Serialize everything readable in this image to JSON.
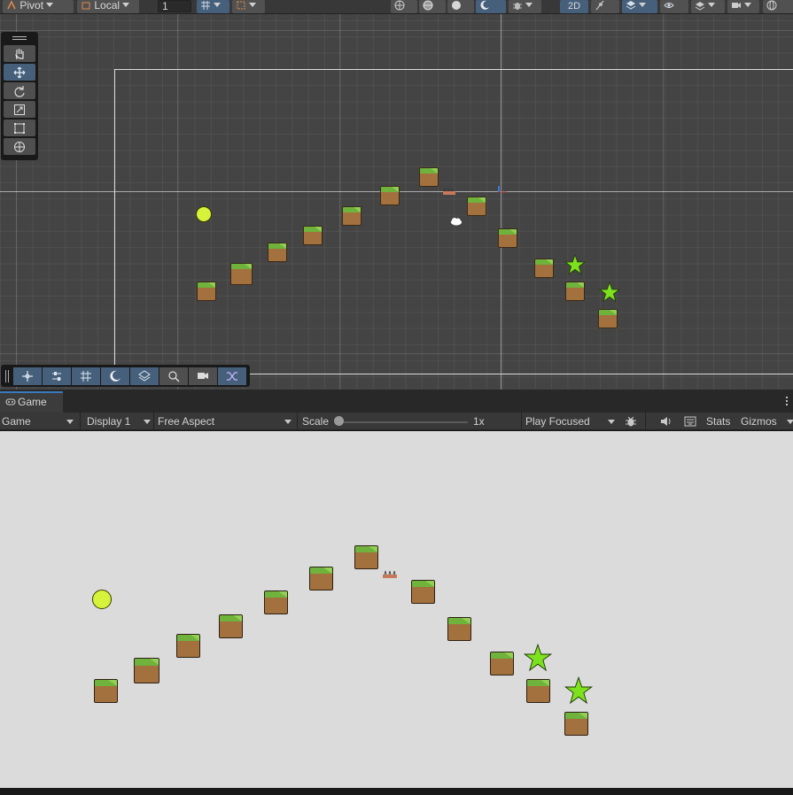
{
  "scene_toolbar": {
    "pivot_label": "Pivot",
    "space_label": "Local",
    "increment_value": "1",
    "mode_2d_label": "2D"
  },
  "scene_tools": [
    "hand-tool",
    "move-tool",
    "rotate-tool",
    "scale-tool",
    "rect-tool",
    "transform-tool"
  ],
  "active_tool": "move-tool",
  "game": {
    "tab_label": "Game",
    "view_dropdown": "Game",
    "display_dropdown": "Display 1",
    "aspect_dropdown": "Free Aspect",
    "scale_label": "Scale",
    "scale_value": "1x",
    "play_mode_dropdown": "Play Focused",
    "stats_label": "Stats",
    "gizmos_label": "Gizmos"
  },
  "colors": {
    "editor_bg": "#383838",
    "scene_bg": "#444444",
    "game_bg": "#dbdbdb",
    "accent_active": "#46607c",
    "tab_highlight": "#3a79bb",
    "ball": "#d6f23a",
    "star": "#7de11e",
    "dirt": "#a2713d",
    "grass": "#6fb23c"
  }
}
